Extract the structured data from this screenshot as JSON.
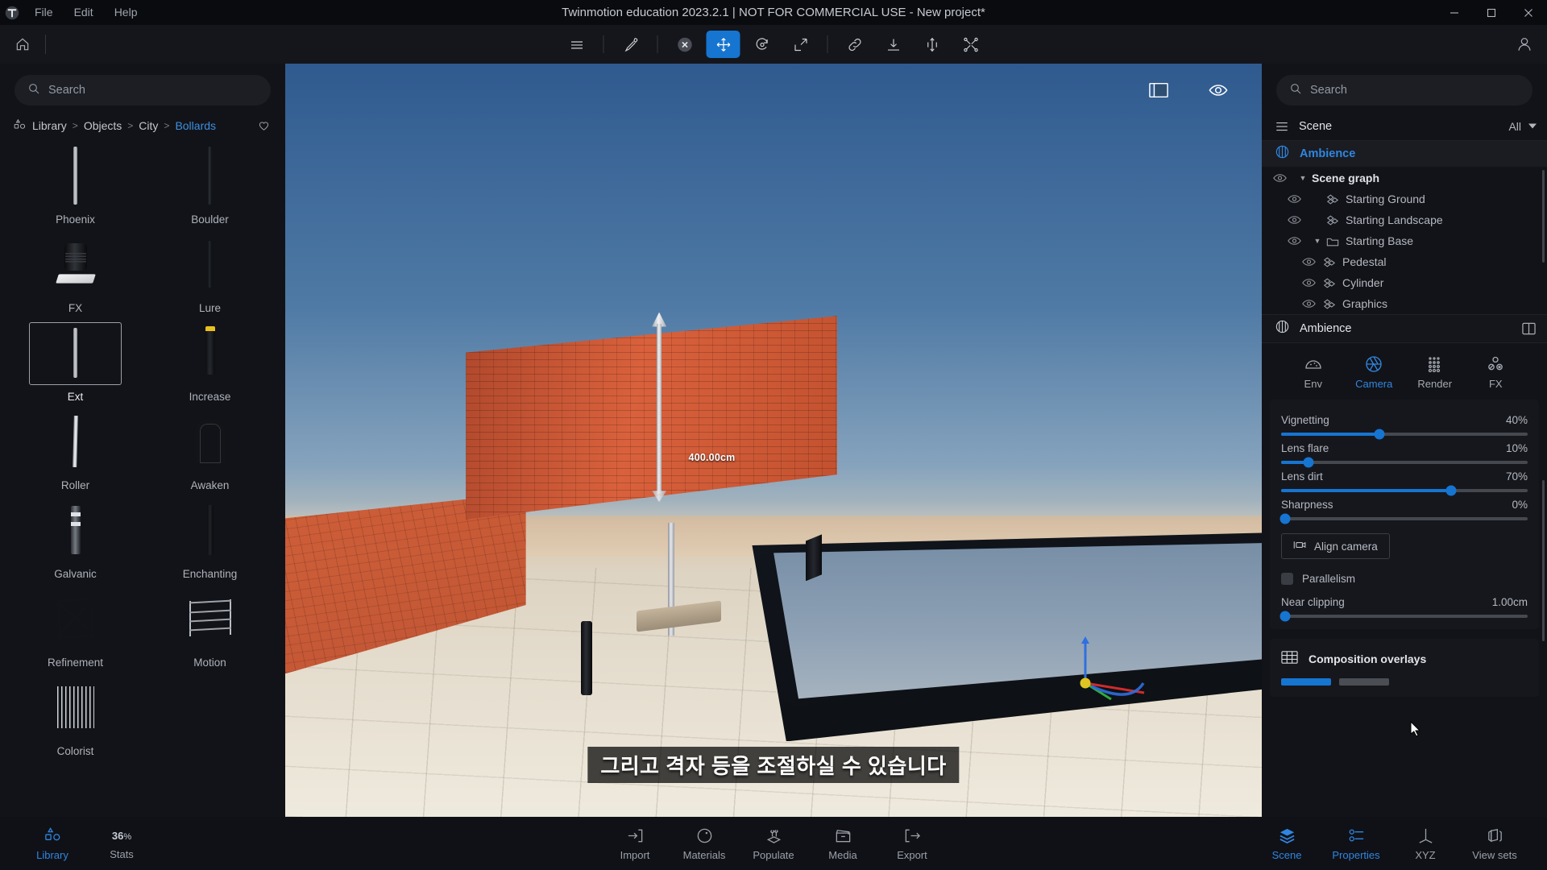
{
  "window": {
    "title": "Twinmotion education 2023.2.1 | NOT FOR COMMERCIAL USE - New project*",
    "menus": [
      {
        "label": "File"
      },
      {
        "label": "Edit"
      },
      {
        "label": "Help"
      }
    ],
    "controls": {
      "minimize": "minimize-icon",
      "maximize": "maximize-icon",
      "close": "close-icon"
    }
  },
  "toolbar": {
    "home_icon": "home-icon",
    "tools": [
      {
        "name": "layers-icon",
        "label": "Layers",
        "active": false
      },
      {
        "name": "eyedropper-icon",
        "label": "Pick material",
        "active": false
      },
      {
        "name": "cancel-icon",
        "label": "Cancel",
        "active": false
      },
      {
        "name": "move-icon",
        "label": "Move",
        "active": true
      },
      {
        "name": "rotate-icon",
        "label": "Rotate",
        "active": false
      },
      {
        "name": "scale-icon",
        "label": "Scale",
        "active": false
      },
      {
        "name": "link-icon",
        "label": "Link",
        "active": false
      },
      {
        "name": "drop-icon",
        "label": "Drop on ground",
        "active": false
      },
      {
        "name": "flip-icon",
        "label": "Flip",
        "active": false
      },
      {
        "name": "distribute-icon",
        "label": "Distribute",
        "active": false
      }
    ],
    "user_icon": "user-account-icon"
  },
  "library": {
    "search": {
      "placeholder": "Search",
      "value": ""
    },
    "breadcrumb": {
      "icon": "library-shapes-icon",
      "items": [
        {
          "label": "Library",
          "active": false
        },
        {
          "label": "Objects",
          "active": false
        },
        {
          "label": "City",
          "active": false
        },
        {
          "label": "Bollards",
          "active": true
        }
      ],
      "separator": ">",
      "favorite_icon": "heart-icon"
    },
    "items": [
      {
        "label": "Phoenix",
        "thumb": "bollard-tall-light",
        "selected": false
      },
      {
        "label": "Boulder",
        "thumb": "bollard-tall-dark",
        "selected": false
      },
      {
        "label": "FX",
        "thumb": "bollard-cylinder-base",
        "selected": false
      },
      {
        "label": "Lure",
        "thumb": "bollard-medium-dark",
        "selected": false
      },
      {
        "label": "Ext",
        "thumb": "bollard-thin-light",
        "selected": true
      },
      {
        "label": "Increase",
        "thumb": "bollard-yellow-top",
        "selected": false
      },
      {
        "label": "Roller",
        "thumb": "bollard-slim-white",
        "selected": false
      },
      {
        "label": "Awaken",
        "thumb": "bollard-arch-hoop",
        "selected": false
      },
      {
        "label": "Galvanic",
        "thumb": "bollard-striped-grey",
        "selected": false
      },
      {
        "label": "Enchanting",
        "thumb": "bollard-plain-black",
        "selected": false
      },
      {
        "label": "Refinement",
        "thumb": "barrier-x-frame",
        "selected": false
      },
      {
        "label": "Motion",
        "thumb": "barrier-rail-fence",
        "selected": false
      },
      {
        "label": "Colorist",
        "thumb": "bollard-multi-posts",
        "selected": false
      }
    ]
  },
  "viewport": {
    "overlay_icons": [
      {
        "name": "panel-toggle-icon"
      },
      {
        "name": "eye-visibility-icon"
      }
    ],
    "dimension_label": "400.00cm",
    "subtitle": "그리고 격자 등을 조절하실 수 있습니다",
    "gizmo": "move-gizmo",
    "axis_gizmo": "axis-orientation-gizmo"
  },
  "scene": {
    "search": {
      "placeholder": "Search",
      "value": ""
    },
    "header": {
      "menu_icon": "hamburger-icon",
      "title": "Scene",
      "filter_label": "All",
      "filter_icon": "chevron-down-icon"
    },
    "ambience": {
      "icon": "ambience-sphere-icon",
      "label": "Ambience"
    },
    "tree": [
      {
        "label": "Scene graph",
        "indent": 1,
        "bold": true,
        "caret": "▼",
        "icon": "",
        "eye": true
      },
      {
        "label": "Starting Ground",
        "indent": 2,
        "bold": false,
        "caret": "",
        "icon": "mesh-icon",
        "eye": true
      },
      {
        "label": "Starting Landscape",
        "indent": 2,
        "bold": false,
        "caret": "",
        "icon": "mesh-icon",
        "eye": true
      },
      {
        "label": "Starting Base",
        "indent": 2,
        "bold": false,
        "caret": "▼",
        "icon": "folder-icon",
        "eye": true
      },
      {
        "label": "Pedestal",
        "indent": 3,
        "bold": false,
        "caret": "",
        "icon": "mesh-icon",
        "eye": true
      },
      {
        "label": "Cylinder",
        "indent": 3,
        "bold": false,
        "caret": "",
        "icon": "mesh-icon",
        "eye": true
      },
      {
        "label": "Graphics",
        "indent": 3,
        "bold": false,
        "caret": "",
        "icon": "mesh-icon",
        "eye": true
      }
    ]
  },
  "properties": {
    "header": {
      "icon": "ambience-sphere-icon",
      "title": "Ambience",
      "split_icon": "split-panel-icon"
    },
    "tabs": [
      {
        "label": "Env",
        "icon": "environment-dome-icon",
        "active": false
      },
      {
        "label": "Camera",
        "icon": "camera-aperture-icon",
        "active": true
      },
      {
        "label": "Render",
        "icon": "render-dots-icon",
        "active": false
      },
      {
        "label": "FX",
        "icon": "fx-circles-icon",
        "active": false
      }
    ],
    "sliders": [
      {
        "label": "Vignetting",
        "value": "40%",
        "percent": 40
      },
      {
        "label": "Lens flare",
        "value": "10%",
        "percent": 10
      },
      {
        "label": "Lens dirt",
        "value": "70%",
        "percent": 70
      },
      {
        "label": "Sharpness",
        "value": "0%",
        "percent": 0
      }
    ],
    "align_camera": {
      "label": "Align camera",
      "icon": "align-camera-icon"
    },
    "parallelism": {
      "label": "Parallelism",
      "checked": false
    },
    "near_clipping": {
      "label": "Near clipping",
      "value": "1.00cm",
      "percent": 1
    },
    "composition_overlays": {
      "label": "Composition overlays",
      "icon": "grid-overlay-icon"
    }
  },
  "bottombar": {
    "left": [
      {
        "label": "Library",
        "icon": "library-shapes-icon",
        "active": true
      },
      {
        "label": "Stats",
        "icon": "stats-icon",
        "active": false,
        "value": "36",
        "unit": "%"
      }
    ],
    "center": [
      {
        "label": "Import",
        "icon": "import-icon",
        "active": false
      },
      {
        "label": "Materials",
        "icon": "materials-sphere-icon",
        "active": false
      },
      {
        "label": "Populate",
        "icon": "populate-plants-icon",
        "active": false
      },
      {
        "label": "Media",
        "icon": "media-clapper-icon",
        "active": false
      },
      {
        "label": "Export",
        "icon": "export-icon",
        "active": false
      }
    ],
    "right": [
      {
        "label": "Scene",
        "icon": "scene-layers-icon",
        "active": true
      },
      {
        "label": "Properties",
        "icon": "properties-sliders-icon",
        "active": true
      },
      {
        "label": "XYZ",
        "icon": "xyz-axes-icon",
        "active": false
      },
      {
        "label": "View sets",
        "icon": "view-sets-icon",
        "active": false
      }
    ]
  },
  "colors": {
    "accent": "#1675d1",
    "accent_text": "#2f86e0",
    "panel_bg": "#121318",
    "window_bg": "#0a0b0f",
    "toolbar_bg": "#15161b"
  }
}
